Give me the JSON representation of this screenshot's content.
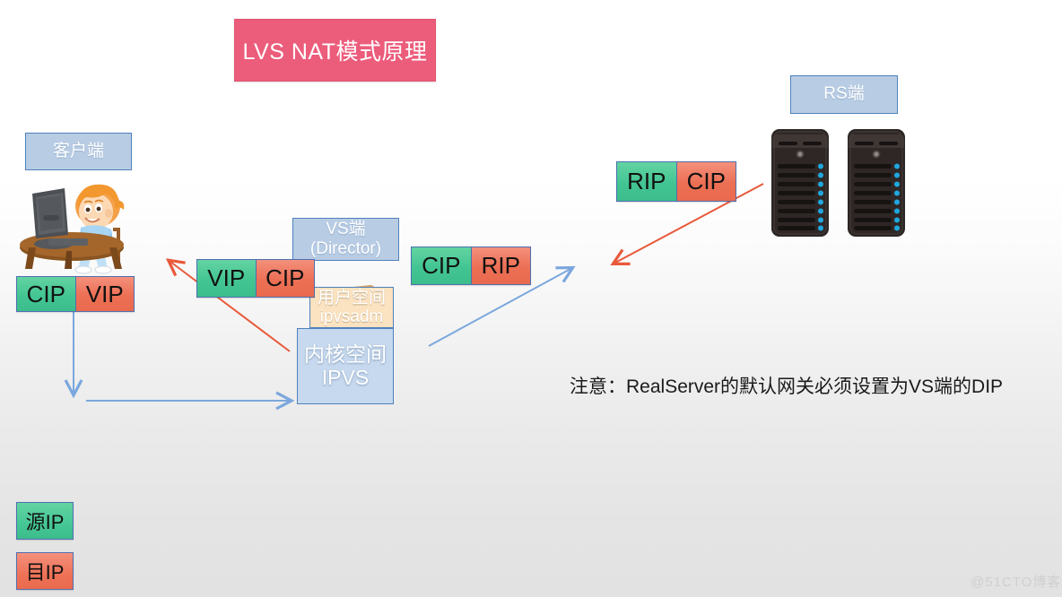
{
  "title": {
    "text": "LVS NAT模式原理"
  },
  "nodes": {
    "client_label": "客户端",
    "vs_label": "VS端\n(Director)",
    "vs_label_line1": "VS端",
    "vs_label_line2": "(Director)",
    "rs_label": "RS端",
    "user_space_line1": "用户空间",
    "user_space_line2": "ipvsadm",
    "kernel_space_line1": "内核空间",
    "kernel_space_line2": "IPVS"
  },
  "packets": [
    {
      "name": "client-packet",
      "src": "CIP",
      "dst": "VIP"
    },
    {
      "name": "director-out-packet",
      "src": "VIP",
      "dst": "CIP"
    },
    {
      "name": "to-rs-packet",
      "src": "CIP",
      "dst": "RIP"
    },
    {
      "name": "from-rs-packet",
      "src": "RIP",
      "dst": "CIP"
    }
  ],
  "legend": [
    {
      "label": "源IP",
      "kind": "src"
    },
    {
      "label": "目IP",
      "kind": "dst"
    }
  ],
  "note": {
    "text": "注意：RealServer的默认网关必须设置为VS端的DIP"
  },
  "watermark": {
    "text": "@51CTO博客"
  },
  "colors": {
    "title_bg": "#ec5c7b",
    "label_bg": "#b8cce4",
    "label_border": "#4f81bd",
    "src_green": "#43c593",
    "dst_orange": "#ec6f54",
    "request_arrow": "#7ba7dd",
    "response_arrow": "#e8593a",
    "user_space_bg": "#fbe2c0",
    "kernel_space_bg": "#c7d9ee",
    "note_text": "#1a1a1a",
    "watermark": "#cfcfcf"
  },
  "arrows": [
    {
      "name": "client-down-arrow",
      "color": "#7ba7dd",
      "direction": "down"
    },
    {
      "name": "client-to-vs-arrow",
      "color": "#7ba7dd",
      "direction": "right"
    },
    {
      "name": "vs-to-rs-arrow",
      "color": "#7ba7dd",
      "direction": "up-right"
    },
    {
      "name": "rs-to-vs-arrow",
      "color": "#e8593a",
      "direction": "down-left"
    },
    {
      "name": "vs-to-client-arrow",
      "color": "#e8593a",
      "direction": "up-left"
    }
  ]
}
